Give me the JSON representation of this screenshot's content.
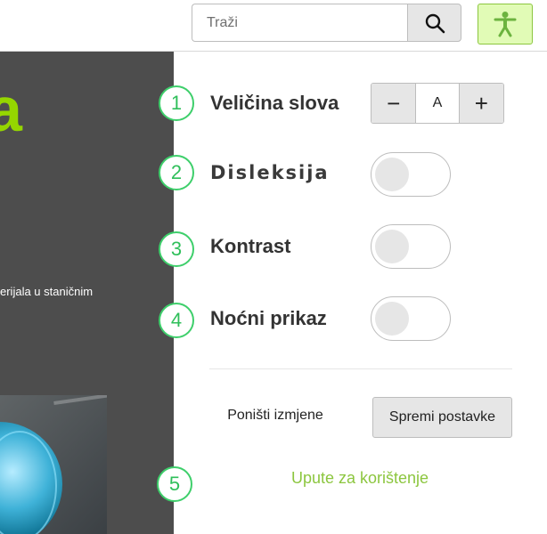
{
  "header": {
    "search_placeholder": "Traži",
    "search_icon": "search-icon",
    "accessibility_icon": "accessibility-person-icon",
    "accessibility_bg": "#e1fbb6",
    "accessibility_border": "#8cc63f"
  },
  "backdrop": {
    "heading_fragment": "a",
    "text_fragment": "erijala u staničnim",
    "heading_color": "#95d600",
    "background_color": "#4d4d4d"
  },
  "panel": {
    "options": [
      {
        "number": "1",
        "label": "Veličina slova",
        "control": "stepper"
      },
      {
        "number": "2",
        "label": "Disleksija",
        "control": "toggle",
        "on": false
      },
      {
        "number": "3",
        "label": "Kontrast",
        "control": "toggle",
        "on": false
      },
      {
        "number": "4",
        "label": "Noćni prikaz",
        "control": "toggle",
        "on": false
      }
    ],
    "font_size": {
      "decrease_label": "−",
      "value": "A",
      "increase_label": "+"
    },
    "reset_label": "Poništi izmjene",
    "save_label": "Spremi postavke",
    "guide": {
      "number": "5",
      "label": "Upute za korištenje"
    },
    "accent_color": "#3ecf6b",
    "link_color": "#8cc63f"
  }
}
